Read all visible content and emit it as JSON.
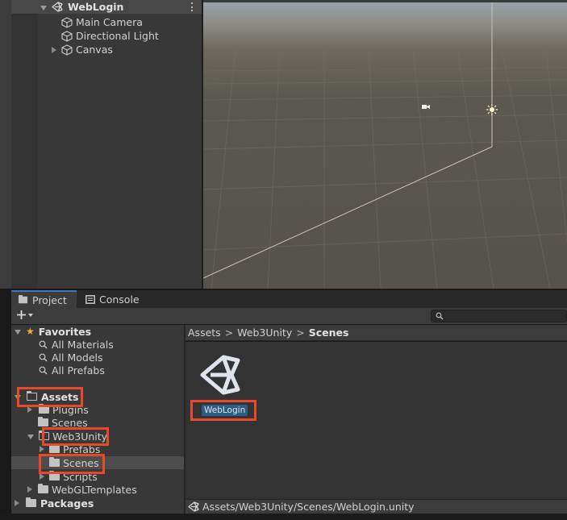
{
  "hierarchy": {
    "scene_name": "WebLogin",
    "items": [
      {
        "label": "Main Camera"
      },
      {
        "label": "Directional Light"
      },
      {
        "label": "Canvas"
      }
    ]
  },
  "project_panel": {
    "tabs": [
      {
        "label": "Project",
        "icon": "folder-icon",
        "active": true
      },
      {
        "label": "Console",
        "icon": "console-icon",
        "active": false
      }
    ],
    "toolbar": {
      "create_icon": "plus-icon",
      "search_icon": "search-icon"
    },
    "tree": {
      "favorites": {
        "label": "Favorites",
        "items": [
          "All Materials",
          "All Models",
          "All Prefabs"
        ]
      },
      "assets": {
        "label": "Assets",
        "children": {
          "plugins": "Plugins",
          "scenes": "Scenes",
          "web3unity": {
            "label": "Web3Unity",
            "children": [
              "Prefabs",
              "Scenes",
              "Scripts"
            ]
          },
          "webgl_templates": "WebGLTemplates"
        }
      },
      "packages": "Packages"
    },
    "breadcrumb": [
      "Assets",
      "Web3Unity",
      "Scenes"
    ],
    "assets": [
      {
        "name": "WebLogin",
        "icon": "unity-logo-icon"
      }
    ],
    "status_path": "Assets/Web3Unity/Scenes/WebLogin.unity"
  },
  "colors": {
    "accent_blue": "#3a79bb",
    "selection_blue": "#2c5d87",
    "annotation_red": "#e8492b",
    "favorite_star": "#e6b32e"
  }
}
